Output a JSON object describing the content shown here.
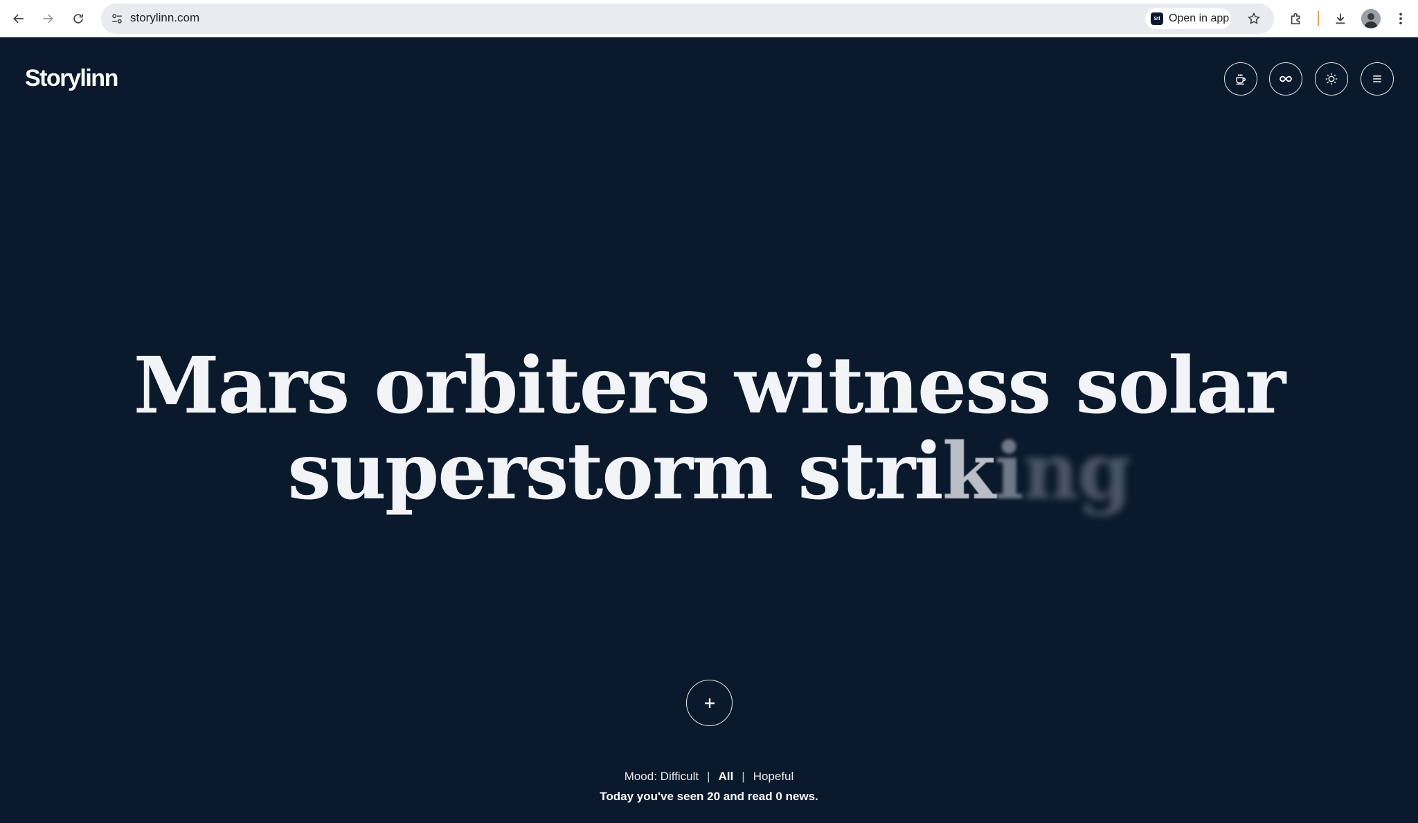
{
  "browser": {
    "url": "storylinn.com",
    "open_in_app_label": "Open in app",
    "app_badge_text": "Stl"
  },
  "site": {
    "logo": "Storylinn",
    "headline": {
      "solid": "Mars orbiters witness solar superstorm stri",
      "fading_1": "k",
      "fading_2": "i",
      "fading_3": "ng"
    },
    "mood": {
      "prefix": "Mood:",
      "options": [
        "Difficult",
        "All",
        "Hopeful"
      ],
      "selected": "All",
      "separator": "|"
    },
    "stats_text": "Today you've seen 20 and read 0 news."
  },
  "icons": {
    "header": [
      "coffee-icon",
      "infinity-icon",
      "theme-sun-icon",
      "menu-icon"
    ],
    "plus": "plus-icon"
  },
  "colors": {
    "background": "#0a1a2c",
    "text": "#f2f4f7"
  }
}
